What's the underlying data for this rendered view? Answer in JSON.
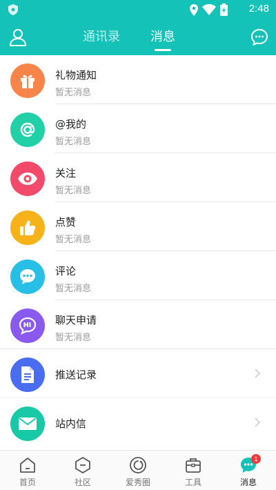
{
  "status_bar": {
    "time": "2:48"
  },
  "header": {
    "tabs": [
      {
        "label": "通讯录",
        "active": false
      },
      {
        "label": "消息",
        "active": true
      }
    ]
  },
  "colors": {
    "primary": "#14c2b8",
    "badge": "#ee3a3a"
  },
  "messages": [
    {
      "title": "礼物通知",
      "subtitle": "暂无消息",
      "icon": "gift-icon",
      "color": "#f7854a"
    },
    {
      "title": "@我的",
      "subtitle": "暂无消息",
      "icon": "at-icon",
      "color": "#22d0a8"
    },
    {
      "title": "关注",
      "subtitle": "暂无消息",
      "icon": "eye-icon",
      "color": "#f24a6a"
    },
    {
      "title": "点赞",
      "subtitle": "暂无消息",
      "icon": "thumbs-up-icon",
      "color": "#f7b21a"
    },
    {
      "title": "评论",
      "subtitle": "暂无消息",
      "icon": "comment-icon",
      "color": "#27bfe6"
    },
    {
      "title": "聊天申请",
      "subtitle": "暂无消息",
      "icon": "chat-hi-icon",
      "color": "#8a5af0"
    }
  ],
  "links": [
    {
      "title": "推送记录",
      "icon": "document-icon",
      "color": "#4a6cf0"
    },
    {
      "title": "站内信",
      "icon": "mail-icon",
      "color": "#18c9a8"
    }
  ],
  "bottom_nav": [
    {
      "label": "首页",
      "icon": "home-icon",
      "active": false
    },
    {
      "label": "社区",
      "icon": "community-icon",
      "active": false
    },
    {
      "label": "爱秀圈",
      "icon": "circle-icon",
      "active": false
    },
    {
      "label": "工具",
      "icon": "toolbox-icon",
      "active": false
    },
    {
      "label": "消息",
      "icon": "message-icon",
      "active": true,
      "badge": "1"
    }
  ]
}
